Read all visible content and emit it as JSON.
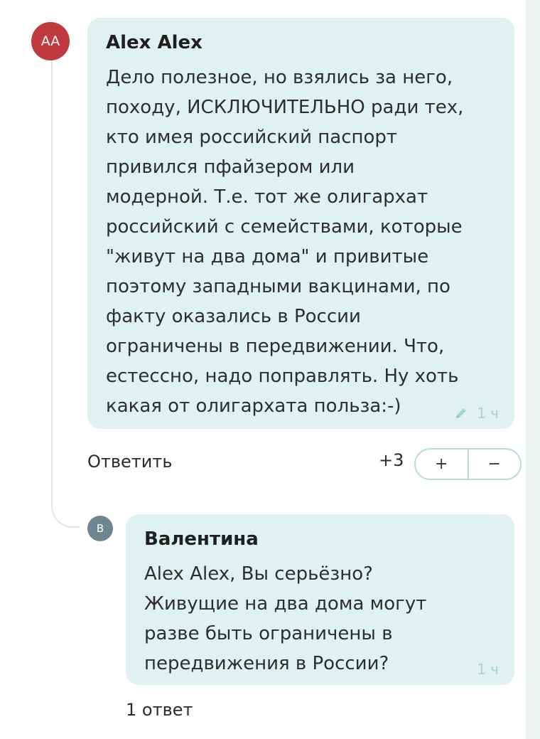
{
  "comment": {
    "avatar_initials": "AA",
    "avatar_color": "#c0393e",
    "author": "Alex Alex",
    "lines": [
      "Дело полезное, но взялись за него,",
      "походу, ИСКЛЮЧИТЕЛЬНО ради тех,",
      "кто имея российский паспорт",
      "привился пфайзером или",
      "модерной. Т.е. тот же олигархат",
      "российский с семействами, которые",
      "\"живут на два дома\" и привитые",
      "поэтому западными вакцинами, по",
      "факту оказались в России",
      "ограничены в передвижении. Что,",
      "естессно, надо поправлять. Ну хоть",
      "какая от олигархата польза:-)"
    ],
    "edited_icon": "pencil-icon",
    "time": "1 ч",
    "actions": {
      "reply_label": "Ответить",
      "score": "+3",
      "upvote_label": "+",
      "downvote_label": "−"
    }
  },
  "reply": {
    "avatar_initials": "В",
    "avatar_color": "#6e8592",
    "author": "Валентина",
    "lines": [
      "Alex Alex, Вы серьёзно?",
      "Живущие на два дома могут",
      "разве быть ограничены в",
      "передвижения в России?"
    ],
    "time": "1 ч"
  },
  "replies_count_label": "1 ответ",
  "colors": {
    "bubble_bg": "#dff2f1",
    "accent": "#a7d6cf",
    "vote_border": "#b9dcd6"
  }
}
